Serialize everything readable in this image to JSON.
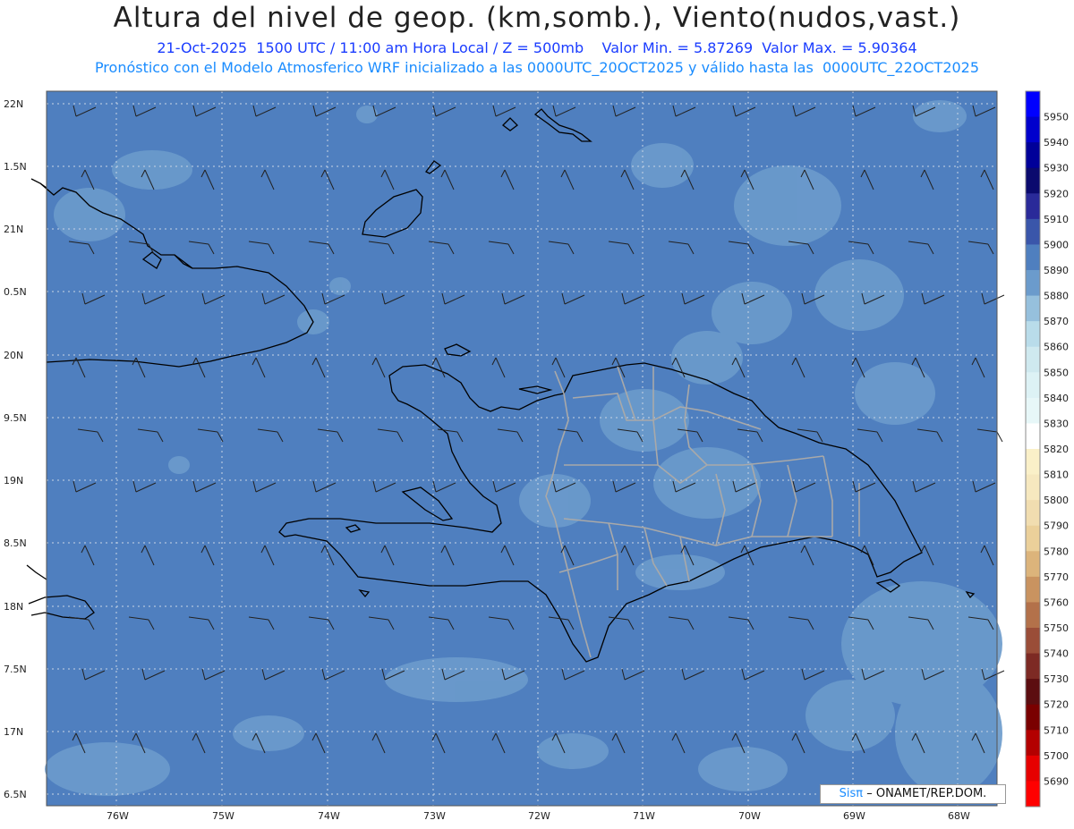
{
  "header": {
    "title": "Altura del nivel de geop. (km,somb.), Viento(nudos,vast.)",
    "line1": "21-Oct-2025  1500 UTC / 11:00 am Hora Local / Z = 500mb    Valor Min. = 5.87269  Valor Max. = 5.90364",
    "line2": "Pronóstico con el Modelo Atmosferico WRF inicializado a las 0000UTC_20OCT2025 y válido hasta las  0000UTC_22OCT2025"
  },
  "axes": {
    "lat_labels": [
      "22N",
      "1.5N",
      "21N",
      "0.5N",
      "20N",
      "9.5N",
      "19N",
      "8.5N",
      "18N",
      "7.5N",
      "17N",
      "6.5N"
    ],
    "lon_labels": [
      "76W",
      "75W",
      "74W",
      "73W",
      "72W",
      "71W",
      "70W",
      "69W",
      "68W"
    ]
  },
  "colorbar": {
    "levels": [
      5950,
      5940,
      5930,
      5920,
      5910,
      5900,
      5890,
      5880,
      5870,
      5860,
      5850,
      5840,
      5830,
      5820,
      5810,
      5800,
      5790,
      5780,
      5770,
      5760,
      5750,
      5740,
      5730,
      5720,
      5710,
      5700,
      5690
    ],
    "colors": [
      "#0000ff",
      "#0000cc",
      "#000099",
      "#0b0a6e",
      "#2a2a99",
      "#3a56aa",
      "#4f7fbf",
      "#6b9bcc",
      "#96c0dd",
      "#b9dcea",
      "#cfe9ef",
      "#ddf2f5",
      "#e7f7f8",
      "#ffffff",
      "#faf0c8",
      "#f6e8bf",
      "#f1ddb0",
      "#ebd09a",
      "#dcb47b",
      "#c99360",
      "#b3714a",
      "#9a4d38",
      "#7d2a24",
      "#5c0d10",
      "#7a0000",
      "#b30000",
      "#e60000",
      "#ff0000"
    ]
  },
  "colors": {
    "field_base": "#4f7fbf",
    "field_light": "#6b9bcc",
    "coast": "#000000",
    "border": "#a9a9a9",
    "grid": "#c8d4e4"
  },
  "credit": {
    "logo": "Sisπ",
    "text": "– ONAMET/REP.DOM."
  }
}
